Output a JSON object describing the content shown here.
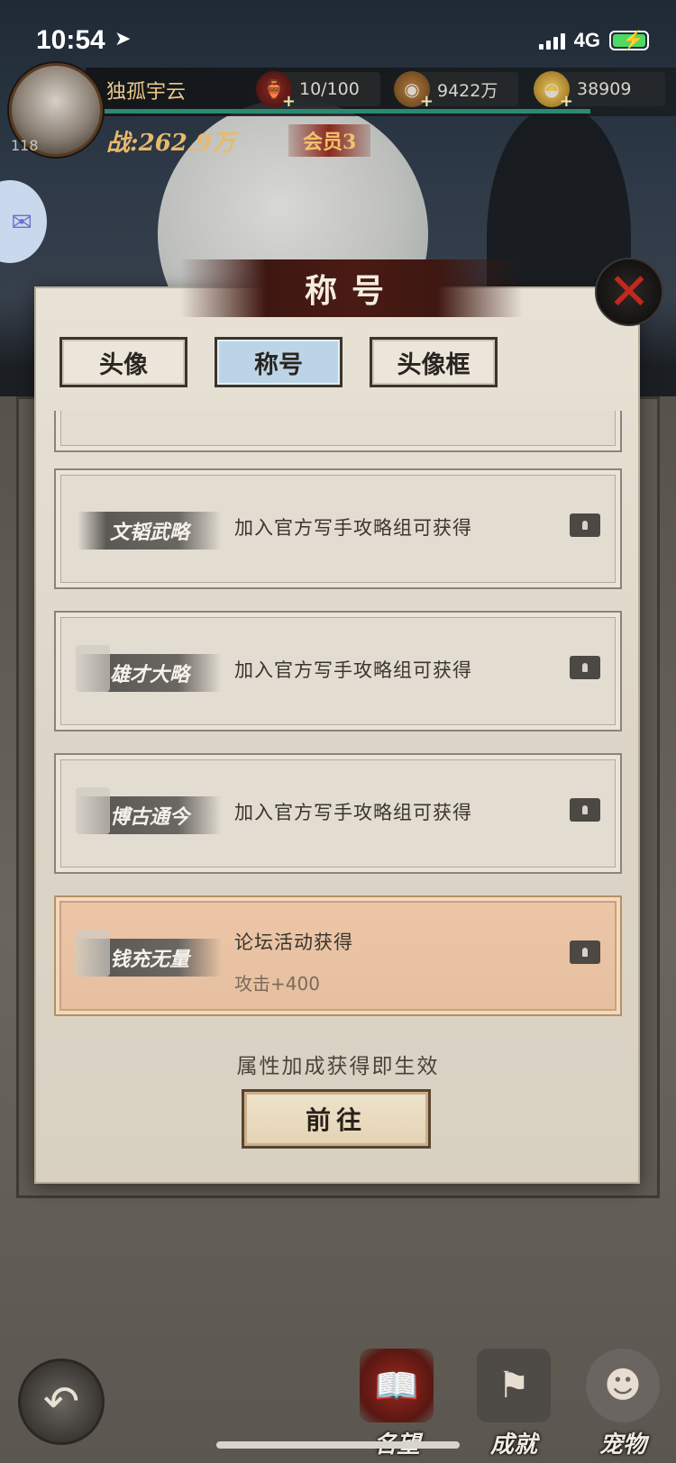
{
  "status_bar": {
    "time": "10:54",
    "location_icon": "location-arrow-icon",
    "network": "4G"
  },
  "player": {
    "name": "独孤宇云",
    "level": "118",
    "power": "战:262.9万",
    "vip": "会员3"
  },
  "resources": [
    {
      "icon": "stamina-pouch-icon",
      "value": "10/100"
    },
    {
      "icon": "copper-coin-icon",
      "value": "9422万"
    },
    {
      "icon": "gold-ingot-icon",
      "value": "38909"
    }
  ],
  "panel": {
    "title": "称号",
    "tabs": [
      {
        "label": "头像",
        "active": false
      },
      {
        "label": "称号",
        "active": true
      },
      {
        "label": "头像框",
        "active": false
      }
    ],
    "titles": [
      {
        "badge": "文韬武略",
        "requirement": "加入官方写手攻略组可获得",
        "bonus": "",
        "selected": false
      },
      {
        "badge": "雄才大略",
        "requirement": "加入官方写手攻略组可获得",
        "bonus": "",
        "selected": false
      },
      {
        "badge": "博古通今",
        "requirement": "加入官方写手攻略组可获得",
        "bonus": "",
        "selected": false
      },
      {
        "badge": "钱充无量",
        "requirement": "论坛活动获得",
        "bonus": "攻击+400",
        "selected": true
      }
    ],
    "note": "属性加成获得即生效",
    "go_button": "前往"
  },
  "bottom_nav": [
    {
      "label": "名望",
      "icon": "reputation-book-icon"
    },
    {
      "label": "成就",
      "icon": "achievement-banner-icon"
    },
    {
      "label": "宠物",
      "icon": "pet-beast-icon"
    }
  ],
  "colors": {
    "accent_red": "#4a1b14",
    "selected_card": "#ecc6a6",
    "active_tab": "#bcd5e6",
    "exp_bar": "#2c8a73"
  }
}
